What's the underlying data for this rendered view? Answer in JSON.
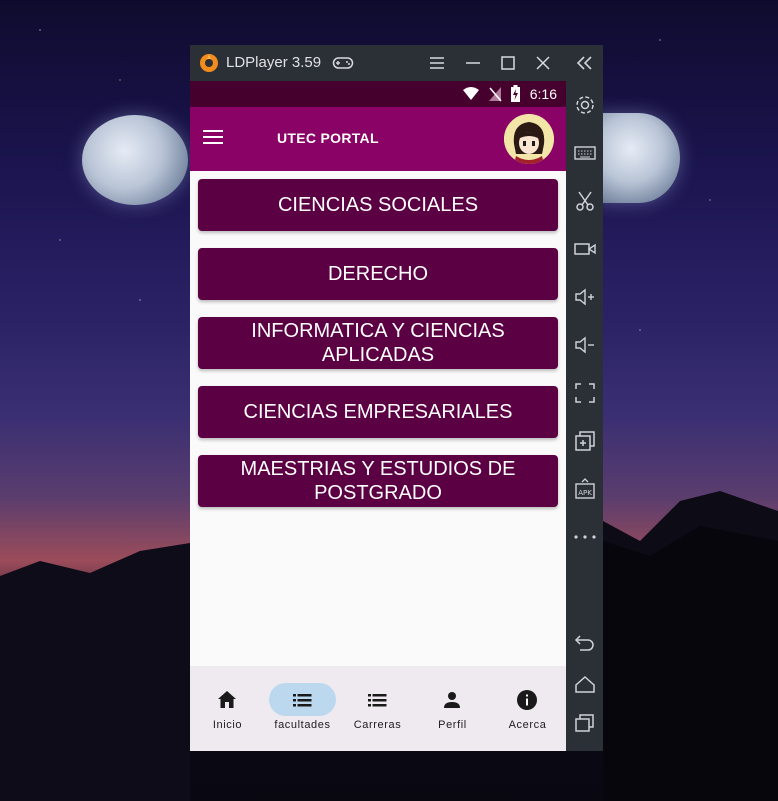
{
  "window": {
    "title": "LDPlayer 3.59",
    "sidebar_icons": [
      "collapse-icon",
      "settings-icon",
      "keyboard-icon",
      "scissors-icon",
      "record-video-icon",
      "volume-up-icon",
      "volume-down-icon",
      "fullscreen-icon",
      "multi-instance-icon",
      "apk-install-icon",
      "more-icon",
      "back-icon",
      "home-icon",
      "recent-apps-icon"
    ]
  },
  "status": {
    "time": "6:16"
  },
  "app": {
    "title": "UTEC PORTAL",
    "colors": {
      "status_bar": "#45002d",
      "app_bar": "#8a0266",
      "button": "#5c0044",
      "nav_active": "#bcd8ef"
    }
  },
  "faculties": [
    {
      "label": "CIENCIAS SOCIALES"
    },
    {
      "label": "DERECHO"
    },
    {
      "label": "INFORMATICA Y CIENCIAS APLICADAS"
    },
    {
      "label": "CIENCIAS EMPRESARIALES"
    },
    {
      "label": "MAESTRIAS Y ESTUDIOS DE POSTGRADO"
    }
  ],
  "bottom_nav": [
    {
      "label": "Inicio",
      "icon": "home-icon",
      "active": false
    },
    {
      "label": "facultades",
      "icon": "list-icon",
      "active": true
    },
    {
      "label": "Carreras",
      "icon": "list-icon",
      "active": false
    },
    {
      "label": "Perfil",
      "icon": "person-icon",
      "active": false
    },
    {
      "label": "Acerca",
      "icon": "info-icon",
      "active": false
    }
  ]
}
